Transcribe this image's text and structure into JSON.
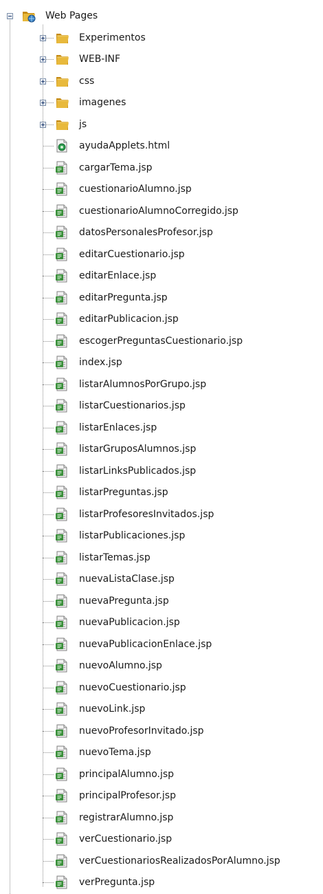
{
  "tree": {
    "root": {
      "label": "Web Pages",
      "icon": "web-pages-folder-icon",
      "expanded": true
    },
    "folders": [
      {
        "label": "Experimentos",
        "icon": "folder-icon",
        "expanded": false
      },
      {
        "label": "WEB-INF",
        "icon": "folder-icon",
        "expanded": false
      },
      {
        "label": "css",
        "icon": "folder-icon",
        "expanded": false
      },
      {
        "label": "imagenes",
        "icon": "folder-icon",
        "expanded": false
      },
      {
        "label": "js",
        "icon": "folder-icon",
        "expanded": false
      }
    ],
    "files": [
      {
        "label": "ayudaApplets.html",
        "icon": "html-file-icon"
      },
      {
        "label": "cargarTema.jsp",
        "icon": "jsp-file-icon"
      },
      {
        "label": "cuestionarioAlumno.jsp",
        "icon": "jsp-file-icon"
      },
      {
        "label": "cuestionarioAlumnoCorregido.jsp",
        "icon": "jsp-file-icon"
      },
      {
        "label": "datosPersonalesProfesor.jsp",
        "icon": "jsp-file-icon"
      },
      {
        "label": "editarCuestionario.jsp",
        "icon": "jsp-file-icon"
      },
      {
        "label": "editarEnlace.jsp",
        "icon": "jsp-file-icon"
      },
      {
        "label": "editarPregunta.jsp",
        "icon": "jsp-file-icon"
      },
      {
        "label": "editarPublicacion.jsp",
        "icon": "jsp-file-icon"
      },
      {
        "label": "escogerPreguntasCuestionario.jsp",
        "icon": "jsp-file-icon"
      },
      {
        "label": "index.jsp",
        "icon": "jsp-file-icon"
      },
      {
        "label": "listarAlumnosPorGrupo.jsp",
        "icon": "jsp-file-icon"
      },
      {
        "label": "listarCuestionarios.jsp",
        "icon": "jsp-file-icon"
      },
      {
        "label": "listarEnlaces.jsp",
        "icon": "jsp-file-icon"
      },
      {
        "label": "listarGruposAlumnos.jsp",
        "icon": "jsp-file-icon"
      },
      {
        "label": "listarLinksPublicados.jsp",
        "icon": "jsp-file-icon"
      },
      {
        "label": "listarPreguntas.jsp",
        "icon": "jsp-file-icon"
      },
      {
        "label": "listarProfesoresInvitados.jsp",
        "icon": "jsp-file-icon"
      },
      {
        "label": "listarPublicaciones.jsp",
        "icon": "jsp-file-icon"
      },
      {
        "label": "listarTemas.jsp",
        "icon": "jsp-file-icon"
      },
      {
        "label": "nuevaListaClase.jsp",
        "icon": "jsp-file-icon"
      },
      {
        "label": "nuevaPregunta.jsp",
        "icon": "jsp-file-icon"
      },
      {
        "label": "nuevaPublicacion.jsp",
        "icon": "jsp-file-icon"
      },
      {
        "label": "nuevaPublicacionEnlace.jsp",
        "icon": "jsp-file-icon"
      },
      {
        "label": "nuevoAlumno.jsp",
        "icon": "jsp-file-icon"
      },
      {
        "label": "nuevoCuestionario.jsp",
        "icon": "jsp-file-icon"
      },
      {
        "label": "nuevoLink.jsp",
        "icon": "jsp-file-icon"
      },
      {
        "label": "nuevoProfesorInvitado.jsp",
        "icon": "jsp-file-icon"
      },
      {
        "label": "nuevoTema.jsp",
        "icon": "jsp-file-icon"
      },
      {
        "label": "principalAlumno.jsp",
        "icon": "jsp-file-icon"
      },
      {
        "label": "principalProfesor.jsp",
        "icon": "jsp-file-icon"
      },
      {
        "label": "registrarAlumno.jsp",
        "icon": "jsp-file-icon"
      },
      {
        "label": "verCuestionario.jsp",
        "icon": "jsp-file-icon"
      },
      {
        "label": "verCuestionariosRealizadosPorAlumno.jsp",
        "icon": "jsp-file-icon"
      },
      {
        "label": "verPregunta.jsp",
        "icon": "jsp-file-icon"
      }
    ]
  },
  "colors": {
    "folder": "#e8b93c",
    "folder_dark": "#c58a12",
    "jsp_badge": "#3a8f3a",
    "html_badge": "#2e9e4f"
  }
}
